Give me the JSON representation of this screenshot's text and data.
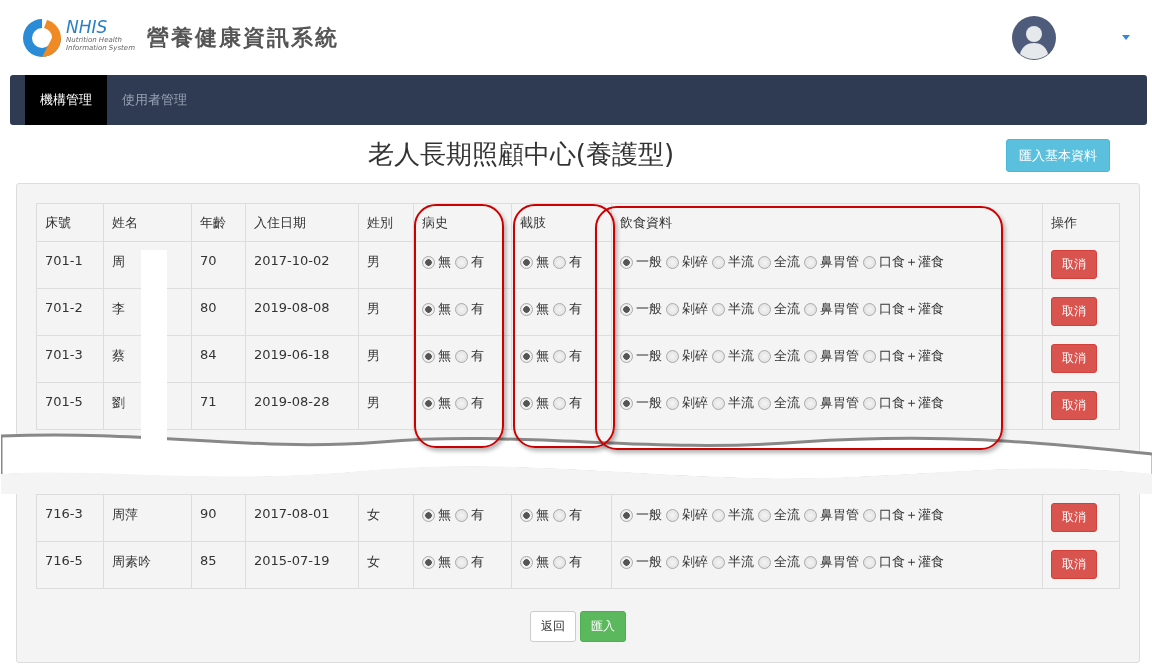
{
  "header": {
    "logo": {
      "abbr": "NHIS",
      "tagline_1": "Nutrition Health",
      "tagline_2": "Information System"
    },
    "title": "營養健康資訊系統"
  },
  "nav": [
    {
      "label": "機構管理",
      "selected": true
    },
    {
      "label": "使用者管理",
      "selected": false
    }
  ],
  "page_title": "老人長期照顧中心(養護型)",
  "import_basic_button": "匯入基本資料",
  "table": {
    "columns": [
      "床號",
      "姓名",
      "年齡",
      "入住日期",
      "姓別",
      "病史",
      "截肢",
      "飲食資料",
      "操作"
    ],
    "rows_before_break": [
      {
        "bed": "701-1",
        "name": "周",
        "age": "70",
        "date": "2017-10-02",
        "sex": "男",
        "history": [
          {
            "label": "無",
            "selected": true
          },
          {
            "label": "有",
            "selected": false
          }
        ],
        "amputation": [
          {
            "label": "無",
            "selected": true
          },
          {
            "label": "有",
            "selected": false
          }
        ],
        "diet": [
          {
            "label": "一般",
            "selected": true
          },
          {
            "label": "剁碎",
            "selected": false
          },
          {
            "label": "半流",
            "selected": false
          },
          {
            "label": "全流",
            "selected": false
          },
          {
            "label": "鼻胃管",
            "selected": false
          },
          {
            "label": "口食＋灌食",
            "selected": false
          }
        ],
        "action": "取消"
      },
      {
        "bed": "701-2",
        "name": "李",
        "age": "80",
        "date": "2019-08-08",
        "sex": "男",
        "history": [
          {
            "label": "無",
            "selected": true
          },
          {
            "label": "有",
            "selected": false
          }
        ],
        "amputation": [
          {
            "label": "無",
            "selected": true
          },
          {
            "label": "有",
            "selected": false
          }
        ],
        "diet": [
          {
            "label": "一般",
            "selected": true
          },
          {
            "label": "剁碎",
            "selected": false
          },
          {
            "label": "半流",
            "selected": false
          },
          {
            "label": "全流",
            "selected": false
          },
          {
            "label": "鼻胃管",
            "selected": false
          },
          {
            "label": "口食＋灌食",
            "selected": false
          }
        ],
        "action": "取消"
      },
      {
        "bed": "701-3",
        "name": "蔡",
        "age": "84",
        "date": "2019-06-18",
        "sex": "男",
        "history": [
          {
            "label": "無",
            "selected": true
          },
          {
            "label": "有",
            "selected": false
          }
        ],
        "amputation": [
          {
            "label": "無",
            "selected": true
          },
          {
            "label": "有",
            "selected": false
          }
        ],
        "diet": [
          {
            "label": "一般",
            "selected": true
          },
          {
            "label": "剁碎",
            "selected": false
          },
          {
            "label": "半流",
            "selected": false
          },
          {
            "label": "全流",
            "selected": false
          },
          {
            "label": "鼻胃管",
            "selected": false
          },
          {
            "label": "口食＋灌食",
            "selected": false
          }
        ],
        "action": "取消"
      },
      {
        "bed": "701-5",
        "name": "劉",
        "age": "71",
        "date": "2019-08-28",
        "sex": "男",
        "history": [
          {
            "label": "無",
            "selected": true
          },
          {
            "label": "有",
            "selected": false
          }
        ],
        "amputation": [
          {
            "label": "無",
            "selected": true
          },
          {
            "label": "有",
            "selected": false
          }
        ],
        "diet": [
          {
            "label": "一般",
            "selected": true
          },
          {
            "label": "剁碎",
            "selected": false
          },
          {
            "label": "半流",
            "selected": false
          },
          {
            "label": "全流",
            "selected": false
          },
          {
            "label": "鼻胃管",
            "selected": false
          },
          {
            "label": "口食＋灌食",
            "selected": false
          }
        ],
        "action": "取消"
      }
    ],
    "rows_after_break": [
      {
        "bed": "716-3",
        "name": "周萍",
        "age": "90",
        "date": "2017-08-01",
        "sex": "女",
        "history": [
          {
            "label": "無",
            "selected": true
          },
          {
            "label": "有",
            "selected": false
          }
        ],
        "amputation": [
          {
            "label": "無",
            "selected": true
          },
          {
            "label": "有",
            "selected": false
          }
        ],
        "diet": [
          {
            "label": "一般",
            "selected": true
          },
          {
            "label": "剁碎",
            "selected": false
          },
          {
            "label": "半流",
            "selected": false
          },
          {
            "label": "全流",
            "selected": false
          },
          {
            "label": "鼻胃管",
            "selected": false
          },
          {
            "label": "口食＋灌食",
            "selected": false
          }
        ],
        "action": "取消"
      },
      {
        "bed": "716-5",
        "name": "周素吟",
        "age": "85",
        "date": "2015-07-19",
        "sex": "女",
        "history": [
          {
            "label": "無",
            "selected": true
          },
          {
            "label": "有",
            "selected": false
          }
        ],
        "amputation": [
          {
            "label": "無",
            "selected": true
          },
          {
            "label": "有",
            "selected": false
          }
        ],
        "diet": [
          {
            "label": "一般",
            "selected": true
          },
          {
            "label": "剁碎",
            "selected": false
          },
          {
            "label": "半流",
            "selected": false
          },
          {
            "label": "全流",
            "selected": false
          },
          {
            "label": "鼻胃管",
            "selected": false
          },
          {
            "label": "口食＋灌食",
            "selected": false
          }
        ],
        "action": "取消"
      }
    ]
  },
  "footer_buttons": [
    {
      "label": "返回",
      "kind": "default"
    },
    {
      "label": "匯入",
      "kind": "success"
    }
  ]
}
